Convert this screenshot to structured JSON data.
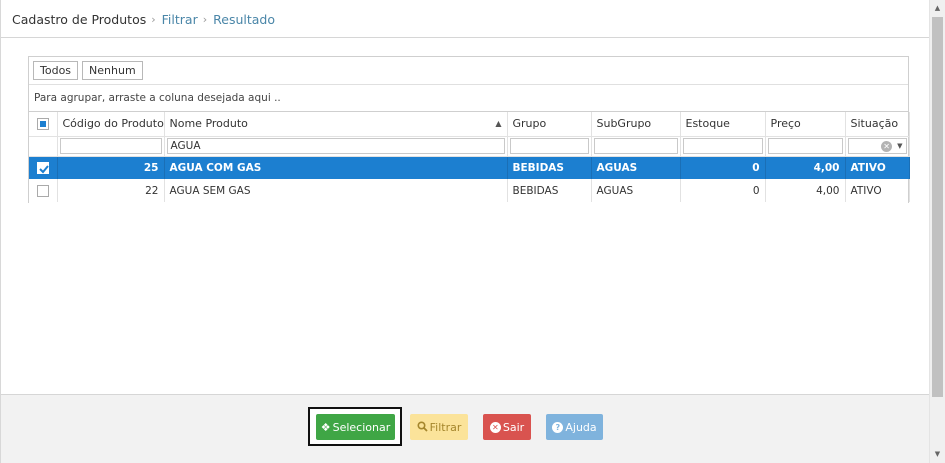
{
  "breadcrumb": {
    "root": "Cadastro de Produtos",
    "items": [
      "Filtrar",
      "Resultado"
    ]
  },
  "grid": {
    "pager_buttons": [
      "Todos",
      "Nenhum"
    ],
    "group_panel_text": "Para agrupar, arraste a coluna desejada aqui ..",
    "columns": [
      "Código do Produto",
      "Nome Produto",
      "Grupo",
      "SubGrupo",
      "Estoque",
      "Preço",
      "Situação"
    ],
    "sorted_column": "Nome Produto",
    "sort_direction": "ascending",
    "filters": {
      "nome_produto": "AGUA",
      "codigo": "",
      "grupo": "",
      "subgrupo": "",
      "estoque": "",
      "preco": ""
    },
    "rows": [
      {
        "codigo": "25",
        "nome": "AGUA COM GAS",
        "grupo": "BEBIDAS",
        "subgrupo": "AGUAS",
        "estoque": "0",
        "preco": "4,00",
        "situacao": "ATIVO",
        "selected": true
      },
      {
        "codigo": "22",
        "nome": "AGUA SEM GAS",
        "grupo": "BEBIDAS",
        "subgrupo": "AGUAS",
        "estoque": "0",
        "preco": "4,00",
        "situacao": "ATIVO",
        "selected": false
      }
    ]
  },
  "footer": {
    "selecionar": "Selecionar",
    "filtrar": "Filtrar",
    "sair": "Sair",
    "ajuda": "Ajuda"
  },
  "colors": {
    "selected_row": "#1c7fd0",
    "btn_selecionar": "#3fa645",
    "btn_filtrar": "#fbe39a",
    "btn_sair": "#d9534f",
    "btn_ajuda": "#7fb3dd",
    "breadcrumb_link": "#4a86a8"
  },
  "icons": {
    "selecionar": "diamond-move-icon",
    "filtrar": "search-icon",
    "sair": "close-circle-icon",
    "ajuda": "help-circle-icon"
  }
}
